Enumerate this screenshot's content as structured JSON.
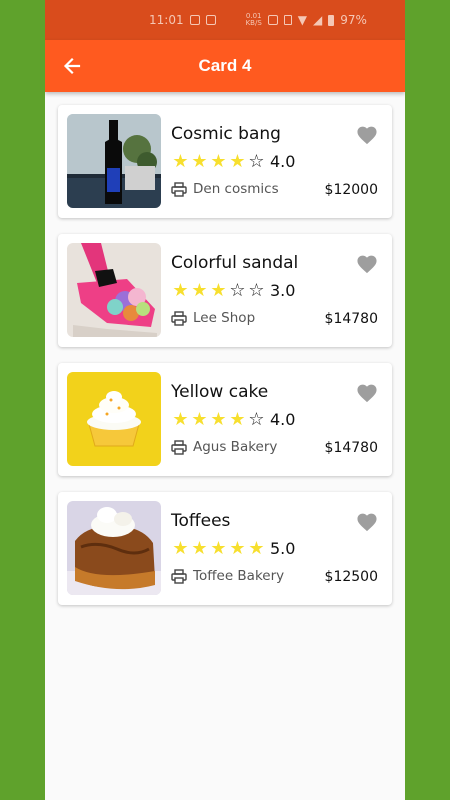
{
  "status_bar": {
    "time": "11:01",
    "battery": "97%"
  },
  "app_bar": {
    "title": "Card 4"
  },
  "colors": {
    "accent": "#ff5a1f",
    "status": "#d94c1c",
    "star": "#f7df2e",
    "background": "#5fa22c"
  },
  "cards": [
    {
      "name": "Cosmic bang",
      "rating": "4.0",
      "rating_num": 4,
      "shop": "Den cosmics",
      "price": "$12000",
      "image": "bottle"
    },
    {
      "name": "Colorful sandal",
      "rating": "3.0",
      "rating_num": 3,
      "shop": "Lee Shop",
      "price": "$14780",
      "image": "sandal"
    },
    {
      "name": "Yellow cake",
      "rating": "4.0",
      "rating_num": 4,
      "shop": "Agus Bakery",
      "price": "$14780",
      "image": "cupcake"
    },
    {
      "name": "Toffees",
      "rating": "5.0",
      "rating_num": 5,
      "shop": "Toffee Bakery",
      "price": "$12500",
      "image": "toffee"
    }
  ]
}
